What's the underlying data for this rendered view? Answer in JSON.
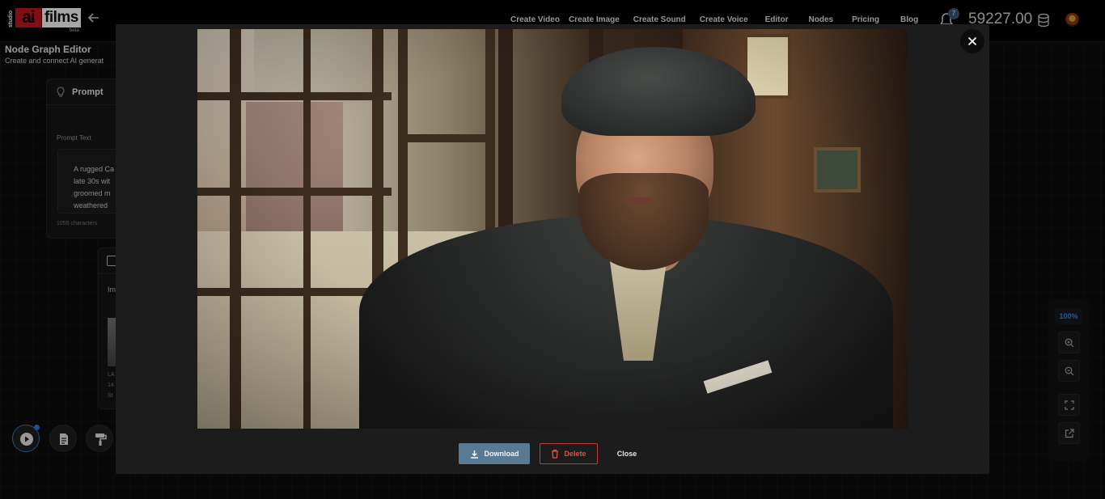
{
  "brand": {
    "studio": "studio",
    "ai": "ai",
    "films": "films",
    "beta": "beta"
  },
  "nav": {
    "items": [
      "Create Video",
      "Create Image",
      "Create Sound",
      "Create Voice",
      "Editor",
      "Nodes",
      "Pricing",
      "Blog"
    ]
  },
  "notifications": {
    "count": "7"
  },
  "balance": "59227.00",
  "page": {
    "title": "Node Graph Editor",
    "subtitle": "Create and connect AI generat"
  },
  "prompt_node": {
    "title": "Prompt",
    "label": "Prompt Text",
    "text": "A rugged Ca late 30s wit groomed m weathered ",
    "char_count": "1055 characters"
  },
  "image_node": {
    "label": "Im",
    "meta_line1": "LA",
    "meta_line2": "14",
    "meta_line3": "St"
  },
  "zoom": {
    "level": "100%"
  },
  "modal": {
    "download_label": "Download",
    "delete_label": "Delete",
    "close_label": "Close"
  },
  "colors": {
    "accent": "#3f86d8",
    "download_bg": "#5a7a94",
    "delete": "#e05050",
    "brand_red": "#c8141e"
  },
  "icons": {
    "back": "arrow-left-icon",
    "bell": "bell-icon",
    "coin": "database-icon",
    "close": "close-icon",
    "download": "download-icon",
    "delete": "trash-icon",
    "zoom_in": "zoom-in-icon",
    "zoom_out": "zoom-out-icon",
    "fit": "fit-screen-icon",
    "open": "open-external-icon"
  }
}
